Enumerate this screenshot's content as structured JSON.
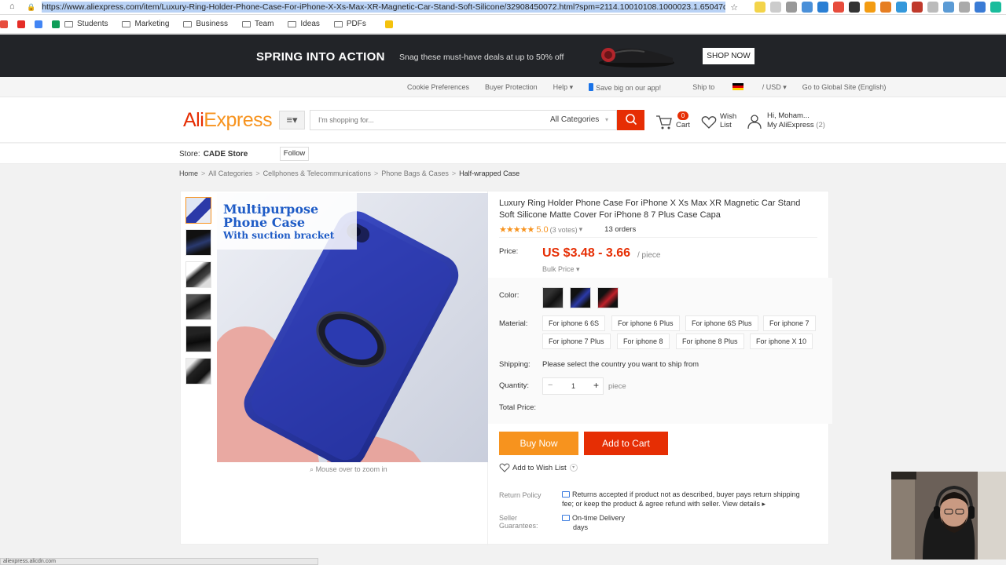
{
  "browser": {
    "url": "https://www.aliexpress.com/item/Luxury-Ring-Holder-Phone-Case-For-iPhone-X-Xs-Max-XR-Magnetic-Car-Stand-Soft-Silicone/32908450072.html?spm=2114.10010108.1000023.1.65047dc",
    "bookmarks": [
      "Students",
      "Marketing",
      "Business",
      "Team",
      "Ideas",
      "PDFs"
    ],
    "status_tip": "aliexpress.alicdn.com"
  },
  "banner": {
    "title": "SPRING INTO ACTION",
    "subtitle": "Snag these must-have deals at up to 50% off",
    "button": "SHOP NOW"
  },
  "topnav": {
    "links": [
      "Cookie Preferences",
      "Buyer Protection",
      "Help ▾",
      "Save big on our app!",
      "Ship to",
      "/ USD ▾",
      "Go to Global Site (English)"
    ]
  },
  "header": {
    "logo_ali": "Ali",
    "logo_express": "Express",
    "search_placeholder": "I'm shopping for...",
    "search_category": "All Categories",
    "cart_label": "Cart",
    "cart_count": "0",
    "wish_label": "Wish List",
    "account_greeting": "Hi, Moham...",
    "account_label": "My AliExpress",
    "account_count": "(2)"
  },
  "store": {
    "label": "Store:",
    "name": "CADE Store",
    "follow": "Follow"
  },
  "breadcrumb": [
    "Home",
    "All Categories",
    "Cellphones & Telecommunications",
    "Phone Bags & Cases",
    "Half-wrapped Case"
  ],
  "gallery": {
    "banner_line1": "Multipurpose",
    "banner_line2": "Phone Case",
    "banner_line3": "With suction bracket",
    "zoom_hint": "Mouse over to zoom in"
  },
  "product": {
    "title": "Luxury Ring Holder Phone Case For iPhone X Xs Max XR Magnetic Car Stand Soft Silicone Matte Cover For iPhone 8 7 Plus Case Capa",
    "rating": "5.0",
    "votes": "(3 votes)",
    "orders": "13 orders",
    "price_label": "Price:",
    "price": "US $3.48 - 3.66",
    "price_unit": "/ piece",
    "bulk_price": "Bulk Price ▾",
    "color_label": "Color:",
    "material_label": "Material:",
    "materials": [
      "For iphone 6 6S",
      "For iphone 6 Plus",
      "For iphone 6S Plus",
      "For iphone 7",
      "For iphone 7 Plus",
      "For iphone 8",
      "For iphone 8 Plus",
      "For iphone X 10"
    ],
    "shipping_label": "Shipping:",
    "shipping_text": "Please select the country you want to ship from",
    "quantity_label": "Quantity:",
    "quantity": "1",
    "quantity_unit": "piece",
    "total_label": "Total Price:",
    "buy_now": "Buy Now",
    "add_to_cart": "Add to Cart",
    "add_to_wishlist": "Add to Wish List",
    "return_label": "Return Policy",
    "return_text": "Returns accepted if product not as described, buyer pays return shipping fee; or keep the product & agree refund with seller.",
    "view_details": "View details ▸",
    "guarantee_label": "Seller Guarantees:",
    "guarantee_text": "On-time Delivery",
    "guarantee_days": "days"
  },
  "colors": {
    "brand_red": "#e62e04",
    "brand_orange": "#f7931e",
    "case_blue": "#2b3aa8"
  }
}
